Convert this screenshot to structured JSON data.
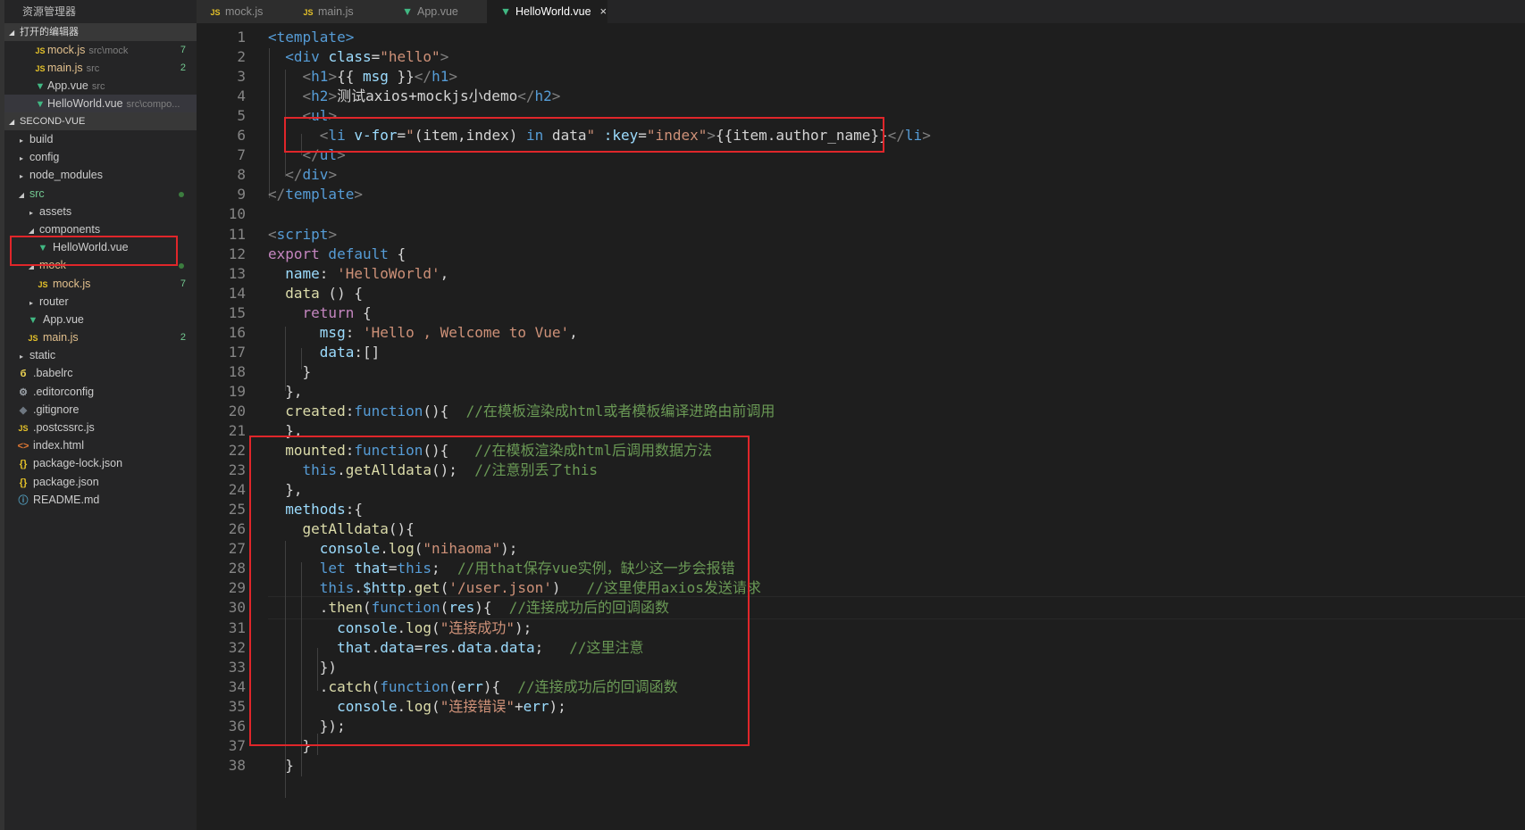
{
  "explorer": {
    "title": "资源管理器",
    "open_editors_label": "打开的编辑器",
    "open_editors": [
      {
        "icon": "js-icon",
        "name": "mock.js",
        "path": "src\\mock",
        "badge": "7"
      },
      {
        "icon": "js-icon",
        "name": "main.js",
        "path": "src",
        "badge": "2"
      },
      {
        "icon": "vue-icon",
        "name": "App.vue",
        "path": "src",
        "badge": ""
      },
      {
        "icon": "vue-icon",
        "name": "HelloWorld.vue",
        "path": "src\\compo...",
        "badge": ""
      }
    ],
    "project_label": "SECOND-VUE",
    "tree": [
      {
        "name": "build",
        "type": "folder"
      },
      {
        "name": "config",
        "type": "folder"
      },
      {
        "name": "node_modules",
        "type": "folder"
      },
      {
        "name": "src",
        "type": "folder-open"
      },
      {
        "name": "assets",
        "type": "folder"
      },
      {
        "name": "components",
        "type": "folder-open"
      },
      {
        "name": "HelloWorld.vue",
        "type": "vue"
      },
      {
        "name": "mock",
        "type": "folder-open"
      },
      {
        "name": "mock.js",
        "type": "js",
        "badge": "7"
      },
      {
        "name": "router",
        "type": "folder"
      },
      {
        "name": "App.vue",
        "type": "vue"
      },
      {
        "name": "main.js",
        "type": "js",
        "badge": "2"
      },
      {
        "name": "static",
        "type": "folder"
      },
      {
        "name": ".babelrc",
        "type": "babel"
      },
      {
        "name": ".editorconfig",
        "type": "gear"
      },
      {
        "name": ".gitignore",
        "type": "git"
      },
      {
        "name": ".postcssrc.js",
        "type": "js"
      },
      {
        "name": "index.html",
        "type": "html"
      },
      {
        "name": "package-lock.json",
        "type": "json"
      },
      {
        "name": "package.json",
        "type": "json"
      },
      {
        "name": "README.md",
        "type": "info"
      }
    ]
  },
  "tabs": [
    {
      "label": "mock.js",
      "icon": "js-icon"
    },
    {
      "label": "main.js",
      "icon": "js-icon"
    },
    {
      "label": "App.vue",
      "icon": "vue-icon"
    },
    {
      "label": "HelloWorld.vue",
      "icon": "vue-icon",
      "active": true
    }
  ],
  "icons": {
    "js": "JS",
    "vue": "▼",
    "close": "×",
    "gear": "⚙",
    "brace": "{}",
    "html": "<>",
    "info": "ⓘ",
    "babel": "б",
    "git": "◆"
  },
  "line_numbers": [
    "1",
    "2",
    "3",
    "4",
    "5",
    "6",
    "7",
    "8",
    "9",
    "10",
    "11",
    "12",
    "13",
    "14",
    "15",
    "16",
    "17",
    "18",
    "19",
    "20",
    "21",
    "22",
    "23",
    "24",
    "25",
    "26",
    "27",
    "28",
    "29",
    "30",
    "31",
    "32",
    "33",
    "34",
    "35",
    "36",
    "37",
    "38"
  ],
  "code_lines": [
    [
      [
        "t",
        "<template>"
      ]
    ],
    [
      [
        "t",
        "  <div "
      ],
      [
        "at",
        "class"
      ],
      [
        "pl",
        "="
      ],
      [
        "st",
        "\"hello\""
      ],
      [
        "tb",
        ">"
      ]
    ],
    [
      [
        "tb",
        "    <"
      ],
      [
        "t",
        "h1"
      ],
      [
        "tb",
        ">"
      ],
      [
        "pl",
        "{{ "
      ],
      [
        "vr",
        "msg"
      ],
      [
        "pl",
        " }}"
      ],
      [
        "tb",
        "</"
      ],
      [
        "t",
        "h1"
      ],
      [
        "tb",
        ">"
      ]
    ],
    [
      [
        "tb",
        "    <"
      ],
      [
        "t",
        "h2"
      ],
      [
        "tb",
        ">"
      ],
      [
        "pl",
        "测试axios+mockjs小demo"
      ],
      [
        "tb",
        "</"
      ],
      [
        "t",
        "h2"
      ],
      [
        "tb",
        ">"
      ]
    ],
    [
      [
        "tb",
        "    <"
      ],
      [
        "t",
        "ul"
      ],
      [
        "tb",
        ">"
      ]
    ],
    [
      [
        "tb",
        "      <"
      ],
      [
        "t",
        "li "
      ],
      [
        "at",
        "v-for"
      ],
      [
        "pl",
        "="
      ],
      [
        "st",
        "\""
      ],
      [
        "pl",
        "(item,index) "
      ],
      [
        "kw",
        "in"
      ],
      [
        "pl",
        " data"
      ],
      [
        "st",
        "\""
      ],
      [
        "at",
        " :key"
      ],
      [
        "pl",
        "="
      ],
      [
        "st",
        "\"index\""
      ],
      [
        "tb",
        ">"
      ],
      [
        "pl",
        "{{item.author_name}}"
      ],
      [
        "tb",
        "</"
      ],
      [
        "t",
        "li"
      ],
      [
        "tb",
        ">"
      ]
    ],
    [
      [
        "tb",
        "    </"
      ],
      [
        "t",
        "ul"
      ],
      [
        "tb",
        ">"
      ]
    ],
    [
      [
        "tb",
        "  </"
      ],
      [
        "t",
        "div"
      ],
      [
        "tb",
        ">"
      ]
    ],
    [
      [
        "tb",
        "</"
      ],
      [
        "t",
        "template"
      ],
      [
        "tb",
        ">"
      ]
    ],
    [],
    [
      [
        "tb",
        "<"
      ],
      [
        "t",
        "script"
      ],
      [
        "tb",
        ">"
      ]
    ],
    [
      [
        "ctl",
        "export"
      ],
      [
        "kw",
        " default"
      ],
      [
        "pl",
        " {"
      ]
    ],
    [
      [
        "pl",
        "  "
      ],
      [
        "vr",
        "name"
      ],
      [
        "pl",
        ": "
      ],
      [
        "st",
        "'HelloWorld'"
      ],
      [
        "pl",
        ","
      ]
    ],
    [
      [
        "pl",
        "  "
      ],
      [
        "fn",
        "data"
      ],
      [
        "pl",
        " () {"
      ]
    ],
    [
      [
        "ctl",
        "    return"
      ],
      [
        "pl",
        " {"
      ]
    ],
    [
      [
        "pl",
        "      "
      ],
      [
        "vr",
        "msg"
      ],
      [
        "pl",
        ": "
      ],
      [
        "st",
        "'Hello , Welcome to Vue'"
      ],
      [
        "pl",
        ","
      ]
    ],
    [
      [
        "pl",
        "      "
      ],
      [
        "vr",
        "data"
      ],
      [
        "pl",
        ":[]"
      ]
    ],
    [
      [
        "pl",
        "    }"
      ]
    ],
    [
      [
        "pl",
        "  },"
      ]
    ],
    [
      [
        "pl",
        "  "
      ],
      [
        "fn",
        "created"
      ],
      [
        "pl",
        ":"
      ],
      [
        "kw",
        "function"
      ],
      [
        "pl",
        "(){  "
      ],
      [
        "cm",
        "//在模板渲染成html或者模板编译进路由前调用"
      ]
    ],
    [
      [
        "pl",
        "  },"
      ]
    ],
    [
      [
        "pl",
        "  "
      ],
      [
        "fn",
        "mounted"
      ],
      [
        "pl",
        ":"
      ],
      [
        "kw",
        "function"
      ],
      [
        "pl",
        "(){   "
      ],
      [
        "cm",
        "//在模板渲染成html后调用数据方法"
      ]
    ],
    [
      [
        "pl",
        "    "
      ],
      [
        "kw",
        "this"
      ],
      [
        "pl",
        "."
      ],
      [
        "fn",
        "getAlldata"
      ],
      [
        "pl",
        "();  "
      ],
      [
        "cm",
        "//注意别丢了this"
      ]
    ],
    [
      [
        "pl",
        "  },"
      ]
    ],
    [
      [
        "pl",
        "  "
      ],
      [
        "vr",
        "methods"
      ],
      [
        "pl",
        ":{"
      ]
    ],
    [
      [
        "pl",
        "    "
      ],
      [
        "fn",
        "getAlldata"
      ],
      [
        "pl",
        "(){"
      ]
    ],
    [
      [
        "pl",
        "      "
      ],
      [
        "vr",
        "console"
      ],
      [
        "pl",
        "."
      ],
      [
        "fn",
        "log"
      ],
      [
        "pl",
        "("
      ],
      [
        "st",
        "\"nihaoma\""
      ],
      [
        "pl",
        ");"
      ]
    ],
    [
      [
        "pl",
        "      "
      ],
      [
        "kw",
        "let"
      ],
      [
        "vr",
        " that"
      ],
      [
        "pl",
        "="
      ],
      [
        "kw",
        "this"
      ],
      [
        "pl",
        ";  "
      ],
      [
        "cm",
        "//用that保存vue实例，缺少这一步会报错"
      ]
    ],
    [
      [
        "pl",
        "      "
      ],
      [
        "kw",
        "this"
      ],
      [
        "pl",
        "."
      ],
      [
        "vr",
        "$http"
      ],
      [
        "pl",
        "."
      ],
      [
        "fn",
        "get"
      ],
      [
        "pl",
        "("
      ],
      [
        "st",
        "'/user.json'"
      ],
      [
        "pl",
        ")   "
      ],
      [
        "cm",
        "//这里使用axios发送请求"
      ]
    ],
    [
      [
        "pl",
        "      ."
      ],
      [
        "fn",
        "then"
      ],
      [
        "pl",
        "("
      ],
      [
        "kw",
        "function"
      ],
      [
        "pl",
        "("
      ],
      [
        "vr",
        "res"
      ],
      [
        "pl",
        "){  "
      ],
      [
        "cm",
        "//连接成功后的回调函数"
      ]
    ],
    [
      [
        "pl",
        "        "
      ],
      [
        "vr",
        "console"
      ],
      [
        "pl",
        "."
      ],
      [
        "fn",
        "log"
      ],
      [
        "pl",
        "("
      ],
      [
        "st",
        "\"连接成功\""
      ],
      [
        "pl",
        ");"
      ]
    ],
    [
      [
        "pl",
        "        "
      ],
      [
        "vr",
        "that"
      ],
      [
        "pl",
        "."
      ],
      [
        "vr",
        "data"
      ],
      [
        "pl",
        "="
      ],
      [
        "vr",
        "res"
      ],
      [
        "pl",
        "."
      ],
      [
        "vr",
        "data"
      ],
      [
        "pl",
        "."
      ],
      [
        "vr",
        "data"
      ],
      [
        "pl",
        ";   "
      ],
      [
        "cm",
        "//这里注意"
      ]
    ],
    [
      [
        "pl",
        "      })"
      ]
    ],
    [
      [
        "pl",
        "      ."
      ],
      [
        "fn",
        "catch"
      ],
      [
        "pl",
        "("
      ],
      [
        "kw",
        "function"
      ],
      [
        "pl",
        "("
      ],
      [
        "vr",
        "err"
      ],
      [
        "pl",
        "){  "
      ],
      [
        "cm",
        "//连接成功后的回调函数"
      ]
    ],
    [
      [
        "pl",
        "        "
      ],
      [
        "vr",
        "console"
      ],
      [
        "pl",
        "."
      ],
      [
        "fn",
        "log"
      ],
      [
        "pl",
        "("
      ],
      [
        "st",
        "\"连接错误\""
      ],
      [
        "pl",
        "+"
      ],
      [
        "vr",
        "err"
      ],
      [
        "pl",
        ");"
      ]
    ],
    [
      [
        "pl",
        "      });"
      ]
    ],
    [
      [
        "pl",
        "    }"
      ]
    ],
    [
      [
        "pl",
        "  }"
      ]
    ]
  ]
}
